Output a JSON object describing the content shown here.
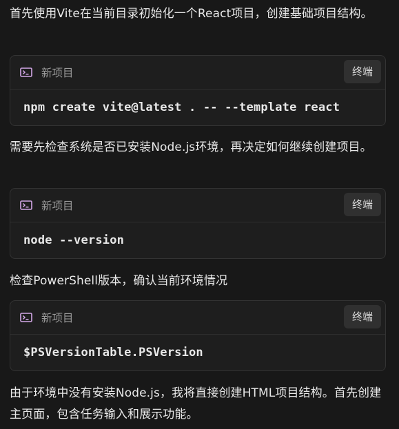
{
  "messages": [
    "首先使用Vite在当前目录初始化一个React项目，创建基础项目结构。",
    "需要先检查系统是否已安装Node.js环境，再决定如何继续创建项目。",
    "检查PowerShell版本，确认当前环境情况",
    "由于环境中没有安装Node.js，我将直接创建HTML项目结构。首先创建主页面，包含任务输入和展示功能。"
  ],
  "command_cards": [
    {
      "icon": "terminal-icon",
      "title": "新项目",
      "button_label": "终端",
      "command": "npm create vite@latest . -- --template react"
    },
    {
      "icon": "terminal-icon",
      "title": "新项目",
      "button_label": "终端",
      "command": "node --version"
    },
    {
      "icon": "terminal-icon",
      "title": "新项目",
      "button_label": "终端",
      "command": "$PSVersionTable.PSVersion"
    }
  ],
  "colors": {
    "background": "#181818",
    "card_background": "#1e1e1e",
    "icon_accent": "#d4a8e8"
  }
}
